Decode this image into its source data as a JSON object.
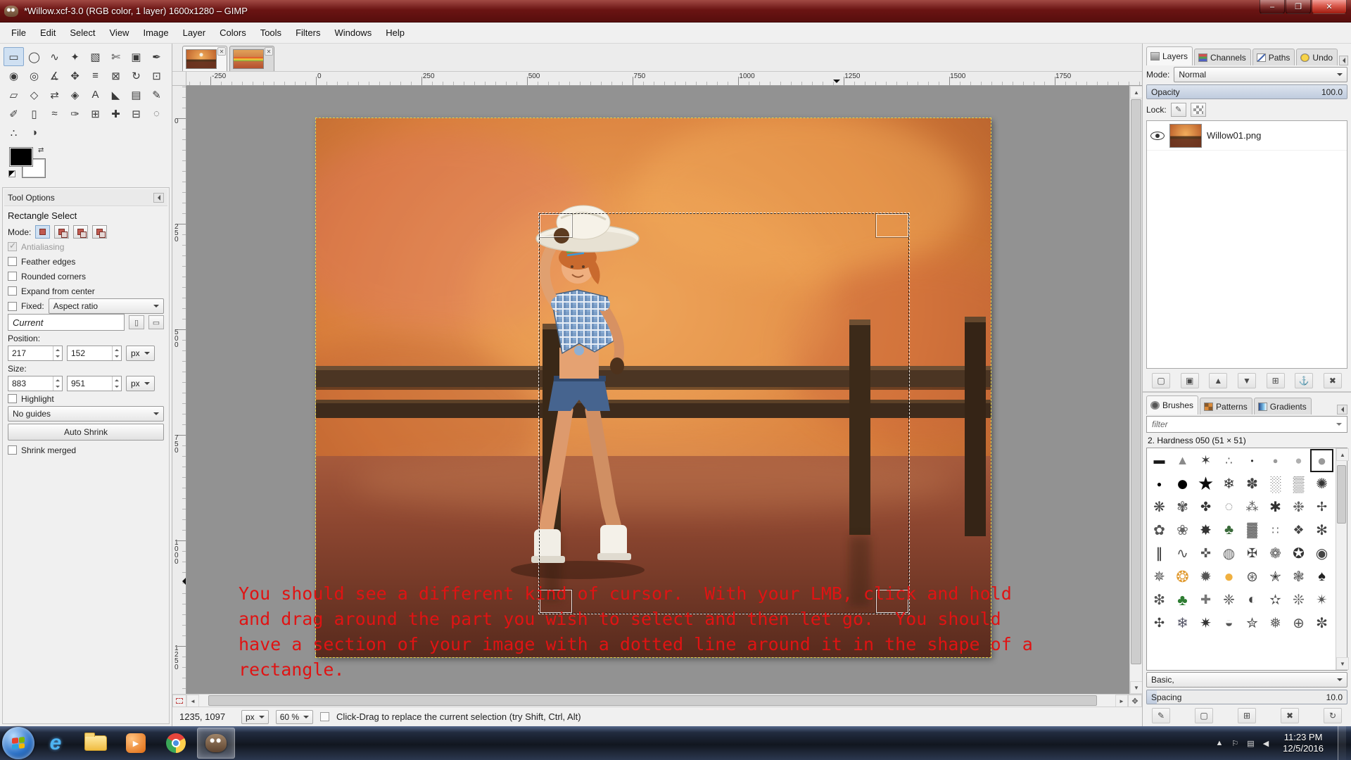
{
  "window": {
    "title": "*Willow.xcf-3.0 (RGB color, 1 layer) 1600x1280 – GIMP",
    "controls": {
      "minimize": "–",
      "maximize": "❐",
      "close": "✕"
    }
  },
  "menu_bar": {
    "items": [
      "File",
      "Edit",
      "Select",
      "View",
      "Image",
      "Layer",
      "Colors",
      "Tools",
      "Filters",
      "Windows",
      "Help"
    ]
  },
  "toolbox": {
    "tools": [
      {
        "name": "rectangle-select",
        "glyph": "▭",
        "active": true
      },
      {
        "name": "ellipse-select",
        "glyph": "◯"
      },
      {
        "name": "free-select",
        "glyph": "∿"
      },
      {
        "name": "fuzzy-select",
        "glyph": "✦"
      },
      {
        "name": "select-by-color",
        "glyph": "▧"
      },
      {
        "name": "scissors-select",
        "glyph": "✄"
      },
      {
        "name": "foreground-select",
        "glyph": "▣"
      },
      {
        "name": "paths",
        "glyph": "✒"
      },
      {
        "name": "color-picker",
        "glyph": "◉"
      },
      {
        "name": "zoom",
        "glyph": "◎"
      },
      {
        "name": "measure",
        "glyph": "∡"
      },
      {
        "name": "move",
        "glyph": "✥"
      },
      {
        "name": "align",
        "glyph": "≡"
      },
      {
        "name": "crop",
        "glyph": "⊠"
      },
      {
        "name": "rotate",
        "glyph": "↻"
      },
      {
        "name": "scale",
        "glyph": "⊡"
      },
      {
        "name": "shear",
        "glyph": "▱"
      },
      {
        "name": "perspective",
        "glyph": "◇"
      },
      {
        "name": "flip",
        "glyph": "⇄"
      },
      {
        "name": "cage-transform",
        "glyph": "◈"
      },
      {
        "name": "text",
        "glyph": "A"
      },
      {
        "name": "bucket-fill",
        "glyph": "◣"
      },
      {
        "name": "gradient",
        "glyph": "▤"
      },
      {
        "name": "pencil",
        "glyph": "✎"
      },
      {
        "name": "paintbrush",
        "glyph": "✐"
      },
      {
        "name": "eraser",
        "glyph": "▯"
      },
      {
        "name": "airbrush",
        "glyph": "≈"
      },
      {
        "name": "ink",
        "glyph": "✑"
      },
      {
        "name": "clone",
        "glyph": "⊞"
      },
      {
        "name": "heal",
        "glyph": "✚"
      },
      {
        "name": "perspective-clone",
        "glyph": "⊟"
      },
      {
        "name": "blur-sharpen",
        "glyph": "◌"
      },
      {
        "name": "smudge",
        "glyph": "∴"
      },
      {
        "name": "dodge-burn",
        "glyph": "◑"
      }
    ]
  },
  "tool_options": {
    "header": "Tool Options",
    "tool_title": "Rectangle Select",
    "mode_label": "Mode:",
    "antialiasing": "Antialiasing",
    "feather": "Feather edges",
    "rounded": "Rounded corners",
    "expand": "Expand from center",
    "fixed_label": "Fixed:",
    "fixed_value": "Aspect ratio",
    "current": "Current",
    "position_label": "Position:",
    "position_x": "217",
    "position_y": "152",
    "position_unit": "px",
    "size_label": "Size:",
    "size_w": "883",
    "size_h": "951",
    "size_unit": "px",
    "highlight": "Highlight",
    "guides_value": "No guides",
    "auto_shrink": "Auto Shrink",
    "shrink_merged": "Shrink merged"
  },
  "canvas": {
    "tab_close": "✕",
    "h_ruler": [
      -250,
      0,
      250,
      500,
      750,
      1000,
      1250,
      1500,
      1750
    ],
    "v_ruler": [
      0,
      250,
      500,
      750,
      1000,
      1250
    ],
    "overlay_lines": [
      "You should see a different kind of cursor.  With your LMB, click and hold",
      "and drag around the part you wish to select and then let go.  You should",
      "have a section of your image with a dotted line around it in the shape of a",
      "rectangle."
    ]
  },
  "status_bar": {
    "position": "1235, 1097",
    "unit": "px",
    "zoom": "60 %",
    "hint": "Click-Drag to replace the current selection (try Shift, Ctrl, Alt)"
  },
  "layers_panel": {
    "tabs": [
      "Layers",
      "Channels",
      "Paths",
      "Undo"
    ],
    "mode_label": "Mode:",
    "mode_value": "Normal",
    "opacity_label": "Opacity",
    "opacity_value": "100.0",
    "lock_label": "Lock:",
    "layer_name": "Willow01.png",
    "buttons": [
      {
        "name": "new-layer",
        "glyph": "▢"
      },
      {
        "name": "new-layer-group",
        "glyph": "▣"
      },
      {
        "name": "raise-layer",
        "glyph": "▲"
      },
      {
        "name": "lower-layer",
        "glyph": "▼"
      },
      {
        "name": "duplicate-layer",
        "glyph": "⊞"
      },
      {
        "name": "anchor-layer",
        "glyph": "⚓"
      },
      {
        "name": "delete-layer",
        "glyph": "✖"
      }
    ]
  },
  "brushes_panel": {
    "tabs": [
      "Brushes",
      "Patterns",
      "Gradients"
    ],
    "filter_placeholder": "filter",
    "selected_brush": "2. Hardness 050 (51 × 51)",
    "preset": "Basic,",
    "spacing_label": "Spacing",
    "spacing_value": "10.0",
    "buttons": [
      {
        "name": "edit-brush",
        "glyph": "✎"
      },
      {
        "name": "new-brush",
        "glyph": "▢"
      },
      {
        "name": "duplicate-brush",
        "glyph": "⊞"
      },
      {
        "name": "delete-brush",
        "glyph": "✖"
      },
      {
        "name": "refresh-brushes",
        "glyph": "↻"
      }
    ],
    "brushes": [
      [
        "▬",
        16,
        "#1a1a1a",
        0
      ],
      [
        "▲",
        18,
        "#8a8a8a",
        0
      ],
      [
        "✶",
        18,
        "#3a3a3a",
        0
      ],
      [
        "∴",
        16,
        "#5a5a5a",
        0
      ],
      [
        "•",
        12,
        "#2a2a2a",
        0
      ],
      [
        "●",
        13,
        "#9a9a9a",
        0
      ],
      [
        "●",
        17,
        "#b0b0b0",
        0
      ],
      [
        "●",
        22,
        "#9a9a9a",
        1
      ],
      [
        "●",
        12,
        "#000000",
        0
      ],
      [
        "●",
        30,
        "#000000",
        0
      ],
      [
        "★",
        26,
        "#0a0a0a",
        0
      ],
      [
        "❄",
        20,
        "#333333",
        0
      ],
      [
        "✽",
        20,
        "#444444",
        0
      ],
      [
        "░",
        22,
        "#666666",
        0
      ],
      [
        "▒",
        22,
        "#555555",
        0
      ],
      [
        "✺",
        20,
        "#333333",
        0
      ],
      [
        "❋",
        20,
        "#444444",
        0
      ],
      [
        "✾",
        20,
        "#555555",
        0
      ],
      [
        "✤",
        18,
        "#333333",
        0
      ],
      [
        "◌",
        20,
        "#777777",
        0
      ],
      [
        "⁂",
        18,
        "#555555",
        0
      ],
      [
        "✱",
        20,
        "#333333",
        0
      ],
      [
        "❉",
        20,
        "#666666",
        0
      ],
      [
        "✢",
        18,
        "#444444",
        0
      ],
      [
        "✿",
        20,
        "#555555",
        0
      ],
      [
        "❀",
        20,
        "#666666",
        0
      ],
      [
        "✸",
        20,
        "#333333",
        0
      ],
      [
        "♣",
        20,
        "#3a6a3a",
        0
      ],
      [
        "▓",
        20,
        "#555555",
        0
      ],
      [
        "∷",
        16,
        "#666666",
        0
      ],
      [
        "❖",
        18,
        "#444444",
        0
      ],
      [
        "✻",
        20,
        "#444444",
        0
      ],
      [
        "∥",
        20,
        "#222222",
        0
      ],
      [
        "∿",
        20,
        "#555555",
        0
      ],
      [
        "✜",
        18,
        "#555555",
        0
      ],
      [
        "◍",
        20,
        "#666666",
        0
      ],
      [
        "✠",
        18,
        "#444444",
        0
      ],
      [
        "❁",
        20,
        "#555555",
        0
      ],
      [
        "✪",
        20,
        "#333333",
        0
      ],
      [
        "◉",
        20,
        "#444444",
        0
      ],
      [
        "✵",
        20,
        "#555555",
        0
      ],
      [
        "❂",
        22,
        "#e09a30",
        0
      ],
      [
        "✹",
        20,
        "#555555",
        0
      ],
      [
        "●",
        24,
        "#f0b040",
        0
      ],
      [
        "⊛",
        20,
        "#555555",
        0
      ],
      [
        "✭",
        20,
        "#333333",
        0
      ],
      [
        "❃",
        20,
        "#666666",
        0
      ],
      [
        "♠",
        20,
        "#222222",
        0
      ],
      [
        "❇",
        20,
        "#555555",
        0
      ],
      [
        "♣",
        22,
        "#2e7d32",
        0
      ],
      [
        "✚",
        18,
        "#777777",
        0
      ],
      [
        "❈",
        20,
        "#555555",
        0
      ],
      [
        "◐",
        20,
        "#444444",
        0
      ],
      [
        "✫",
        20,
        "#555555",
        0
      ],
      [
        "❊",
        20,
        "#666666",
        0
      ],
      [
        "✴",
        20,
        "#555555",
        0
      ],
      [
        "✣",
        18,
        "#444444",
        0
      ],
      [
        "❄",
        20,
        "#555566",
        0
      ],
      [
        "✷",
        20,
        "#333333",
        0
      ],
      [
        "◒",
        20,
        "#555555",
        0
      ],
      [
        "✮",
        20,
        "#444444",
        0
      ],
      [
        "❅",
        20,
        "#666666",
        0
      ],
      [
        "⊕",
        20,
        "#555555",
        0
      ],
      [
        "✼",
        20,
        "#444444",
        0
      ]
    ]
  },
  "taskbar": {
    "apps": [
      {
        "name": "internet-explorer"
      },
      {
        "name": "file-explorer"
      },
      {
        "name": "media-player"
      },
      {
        "name": "chrome"
      },
      {
        "name": "gimp",
        "active": true
      }
    ],
    "tray": [
      {
        "name": "hidden-icons",
        "glyph": "▲"
      },
      {
        "name": "action-center",
        "glyph": "⚐"
      },
      {
        "name": "network",
        "glyph": "▤"
      },
      {
        "name": "volume",
        "glyph": "◀"
      }
    ],
    "time": "11:23 PM",
    "date": "12/5/2016"
  }
}
